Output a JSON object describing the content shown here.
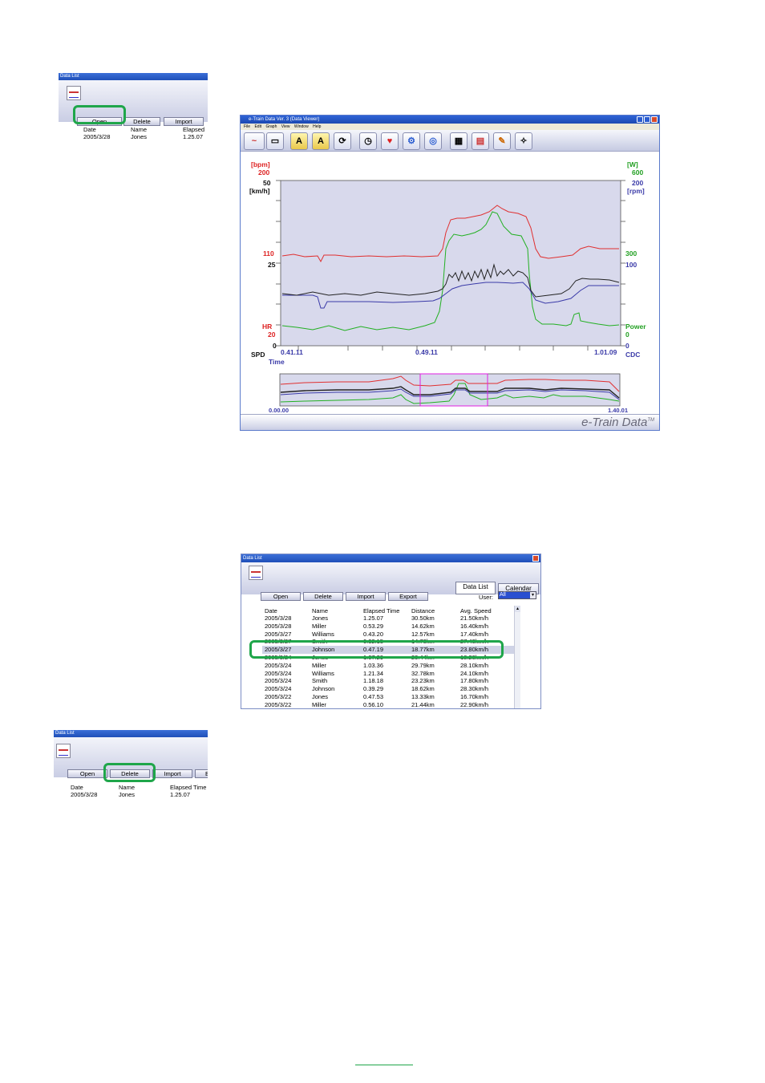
{
  "colors": {
    "highlight": "#1fa64a",
    "hr": "#e03030",
    "power": "#22b022",
    "speed": "#222222",
    "cadence": "#3a3aa8",
    "zoom_box": "#e020e0",
    "plot_bg": "#d8d9ec"
  },
  "snippet_open": {
    "window_title": "Data List",
    "buttons": [
      "Open",
      "Delete",
      "Import"
    ],
    "headers": [
      "Date",
      "Name",
      "Elapsed"
    ],
    "row": [
      "2005/3/28",
      "Jones",
      "1.25.07"
    ]
  },
  "viewer": {
    "window_title": "e-Train Data Ver. 3 (Data Viewer)",
    "menu": [
      "File",
      "Edit",
      "Graph",
      "View",
      "Window",
      "Help"
    ],
    "brand": "e-Train Data",
    "brand_tm": "TM",
    "left_axis": {
      "bpm_unit": "[bpm]",
      "bpm_max": "200",
      "spd_max": "50",
      "spd_unit": "[km/h]",
      "bpm_mid": "110",
      "spd_mid": "25",
      "hr_label": "HR",
      "bpm_min": "20",
      "spd_min": "0",
      "spd_label": "SPD",
      "time_label": "Time"
    },
    "right_axis": {
      "w_unit": "[W]",
      "w_max": "600",
      "rpm_max": "200",
      "rpm_unit": "[rpm]",
      "w_mid": "300",
      "rpm_mid": "100",
      "power_label": "Power",
      "w_min": "0",
      "rpm_min": "0",
      "cdc_label": "CDC"
    },
    "time_ticks": [
      "0.41.11",
      "0.49.11",
      "1.01.09"
    ],
    "overview_start": "0.00.00",
    "overview_end": "1.40.01"
  },
  "data_list": {
    "window_title": "Data List",
    "tabs": [
      "Data List",
      "Calendar"
    ],
    "buttons": [
      "Open",
      "Delete",
      "Import",
      "Export"
    ],
    "user_label": "User:",
    "user_value": "All",
    "headers": [
      "Date",
      "Name",
      "Elapsed Time",
      "Distance",
      "Avg. Speed"
    ],
    "selected_row": 4,
    "rows": [
      [
        "2005/3/28",
        "Jones",
        "1.25.07",
        "30.50km",
        "21.50km/h"
      ],
      [
        "2005/3/28",
        "Miller",
        "0.53.29",
        "14.62km",
        "16.40km/h"
      ],
      [
        "2005/3/27",
        "Williams",
        "0.43.20",
        "12.57km",
        "17.40km/h"
      ],
      [
        "2005/3/27",
        "Smith",
        "0.32.15",
        "14.70km",
        "27.40km/h"
      ],
      [
        "2005/3/27",
        "Johnson",
        "0.47.19",
        "18.77km",
        "23.80km/h"
      ],
      [
        "2005/3/24",
        "Jones",
        "1.07.29",
        "20.44km",
        "18.20km/h"
      ],
      [
        "2005/3/24",
        "Miller",
        "1.03.36",
        "29.79km",
        "28.10km/h"
      ],
      [
        "2005/3/24",
        "Williams",
        "1.21.34",
        "32.78km",
        "24.10km/h"
      ],
      [
        "2005/3/24",
        "Smith",
        "1.18.18",
        "23.23km",
        "17.80km/h"
      ],
      [
        "2005/3/24",
        "Johnson",
        "0.39.29",
        "18.62km",
        "28.30km/h"
      ],
      [
        "2005/3/22",
        "Jones",
        "0.47.53",
        "13.33km",
        "16.70km/h"
      ],
      [
        "2005/3/22",
        "Miller",
        "0.56.10",
        "21.44km",
        "22.90km/h"
      ]
    ]
  },
  "snippet_delete": {
    "window_title": "Data List",
    "buttons": [
      "Open",
      "Delete",
      "Import",
      "E"
    ],
    "headers": [
      "Date",
      "Name",
      "Elapsed Time"
    ],
    "row": [
      "2005/3/28",
      "Jones",
      "1.25.07"
    ]
  }
}
